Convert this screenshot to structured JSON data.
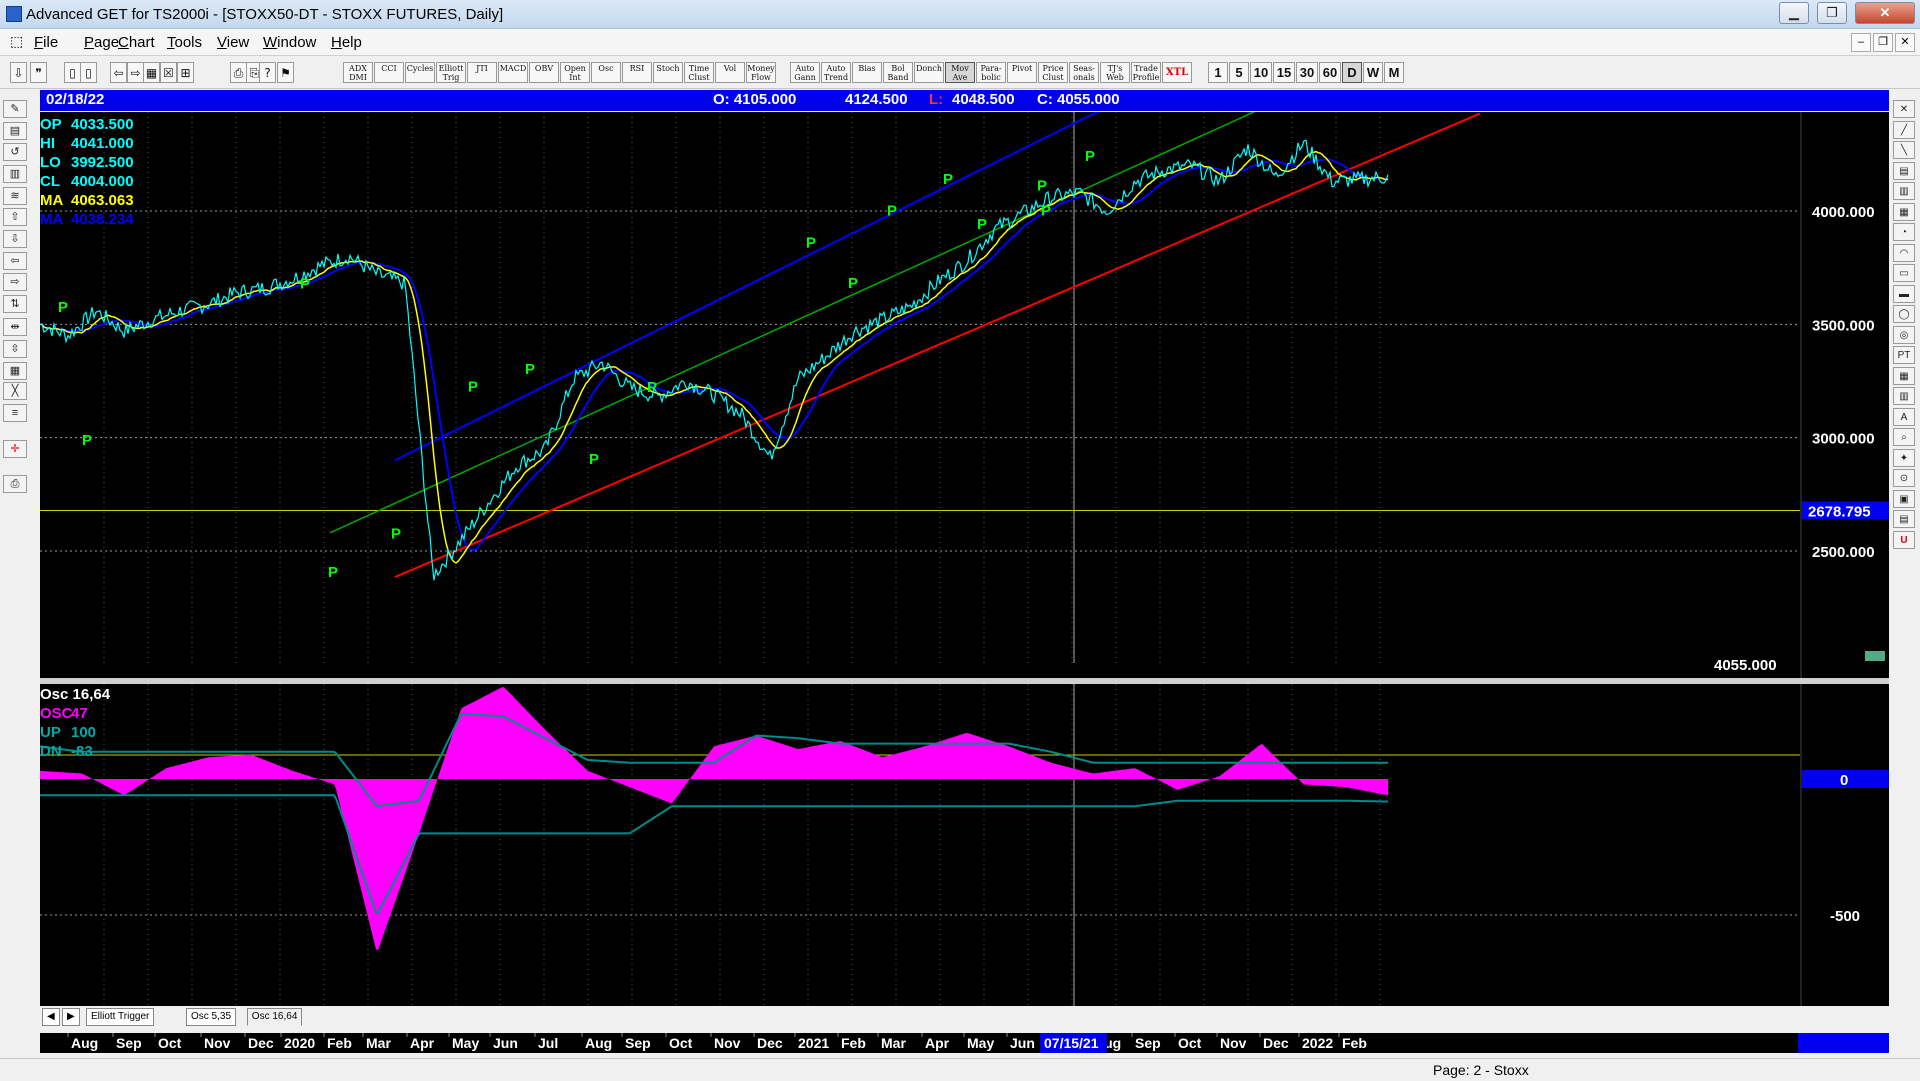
{
  "window": {
    "title": "Advanced GET for TS2000i - [STOXX50-DT - STOXX FUTURES, Daily]"
  },
  "menu": [
    "File",
    "Page",
    "Chart",
    "Tools",
    "View",
    "Window",
    "Help"
  ],
  "toolbar": {
    "indicators": [
      "ADX\nDMI",
      "CCI",
      "Cycles",
      "Elliott\nTrig",
      "JTI",
      "MACD",
      "OBV",
      "Open\nInt",
      "Osc",
      "RSI",
      "Stoch",
      "Time\nClust",
      "Vol",
      "Money\nFlow"
    ],
    "studies": [
      "Auto\nGann",
      "Auto\nTrend",
      "Bias",
      "Bol\nBand",
      "Donch",
      "Mov\nAve",
      "Para-\nbolic",
      "Pivot",
      "Price\nClust",
      "Seas-\nonals",
      "TJ's\nWeb",
      "Trade\nProfile",
      "XTL"
    ],
    "timeframes": [
      "1",
      "5",
      "10",
      "15",
      "30",
      "60",
      "D",
      "W",
      "M"
    ],
    "active_timeframe": "D"
  },
  "header": {
    "date": "02/18/22",
    "open": "O: 4105.000",
    "high": "4124.500",
    "low_prefix": "L:",
    "low": "4048.500",
    "close": "C: 4055.000"
  },
  "price_readout": [
    {
      "label": "OP",
      "value": "4033.500",
      "color": "#00ffff"
    },
    {
      "label": "HI",
      "value": "4041.000",
      "color": "#00ffff"
    },
    {
      "label": "LO",
      "value": "3992.500",
      "color": "#00ffff"
    },
    {
      "label": "CL",
      "value": "4004.000",
      "color": "#00ffff"
    },
    {
      "label": "MA",
      "value": "4063.063",
      "color": "#ffff00"
    },
    {
      "label": "MA",
      "value": "4038.234",
      "color": "#0000ff"
    }
  ],
  "osc_readout": [
    {
      "label": "Osc 16,64",
      "value": "",
      "color": "#ffffff"
    },
    {
      "label": "OSC",
      "value": "47",
      "color": "#ff00ff"
    },
    {
      "label": "UP",
      "value": "100",
      "color": "#00aaaa"
    },
    {
      "label": "DN",
      "value": "-83",
      "color": "#00aaaa"
    }
  ],
  "price_axis": {
    "labels": [
      "4000.000",
      "3500.000",
      "3000.000",
      "2500.000"
    ],
    "highlight": "2678.795",
    "last": "4055.000"
  },
  "osc_axis": {
    "labels": [
      "0",
      "-500"
    ]
  },
  "tabs": [
    "Elliott Trigger",
    "Osc 5,35",
    "Osc 16,64"
  ],
  "active_tab": "Osc 16,64",
  "date_axis": [
    "Aug",
    "Sep",
    "Oct",
    "Nov",
    "Dec",
    "2020",
    "Feb",
    "Mar",
    "Apr",
    "May",
    "Jun",
    "Jul",
    "Aug",
    "Sep",
    "Oct",
    "Nov",
    "Dec",
    "2021",
    "Feb",
    "Mar",
    "Apr",
    "May",
    "Jun",
    "Jul",
    "Aug",
    "Sep",
    "Oct",
    "Nov",
    "Dec",
    "2022",
    "Feb"
  ],
  "cursor_date": "07/15/21",
  "status": "Page: 2 - Stoxx",
  "pivot_marker": "P",
  "colors": {
    "price": "#00ffff",
    "ma_fast": "#ffff00",
    "ma_slow": "#0000ff",
    "osc": "#ff00ff",
    "bands": "#008b8b",
    "trend_red": "#ff0000",
    "trend_blue": "#0000ff",
    "trend_green": "#00aa00",
    "pivot": "#00ff00",
    "header": "#0000ee"
  },
  "chart_data": {
    "type": "line",
    "series": [
      {
        "values": [
          3500,
          3450,
          3560,
          3470,
          3520,
          3560,
          3590,
          3640,
          3660,
          3700,
          3760,
          3800,
          3720,
          3680,
          2390,
          2550,
          2720,
          2880,
          2950,
          3260,
          3330,
          3220,
          3180,
          3250,
          3190,
          3100,
          2910,
          3260,
          3360,
          3470,
          3520,
          3580,
          3690,
          3780,
          3920,
          3990,
          4060,
          4080,
          4000,
          4130,
          4180,
          4200,
          4130,
          4280,
          4150,
          4300,
          4130,
          4140,
          4150
        ]
      }
    ],
    "pivots": [
      3555,
      2968,
      3658,
      2385,
      2555,
      3203,
      3280,
      2884,
      3202,
      3660,
      3840,
      3980,
      4120,
      3920,
      4090,
      3980,
      4220
    ],
    "trend_support": [
      2530,
      2940,
      3280,
      3680,
      4180
    ],
    "y_ticks": [
      4000,
      3500,
      3000,
      2500
    ],
    "osc_ticks": [
      0,
      -500
    ]
  }
}
